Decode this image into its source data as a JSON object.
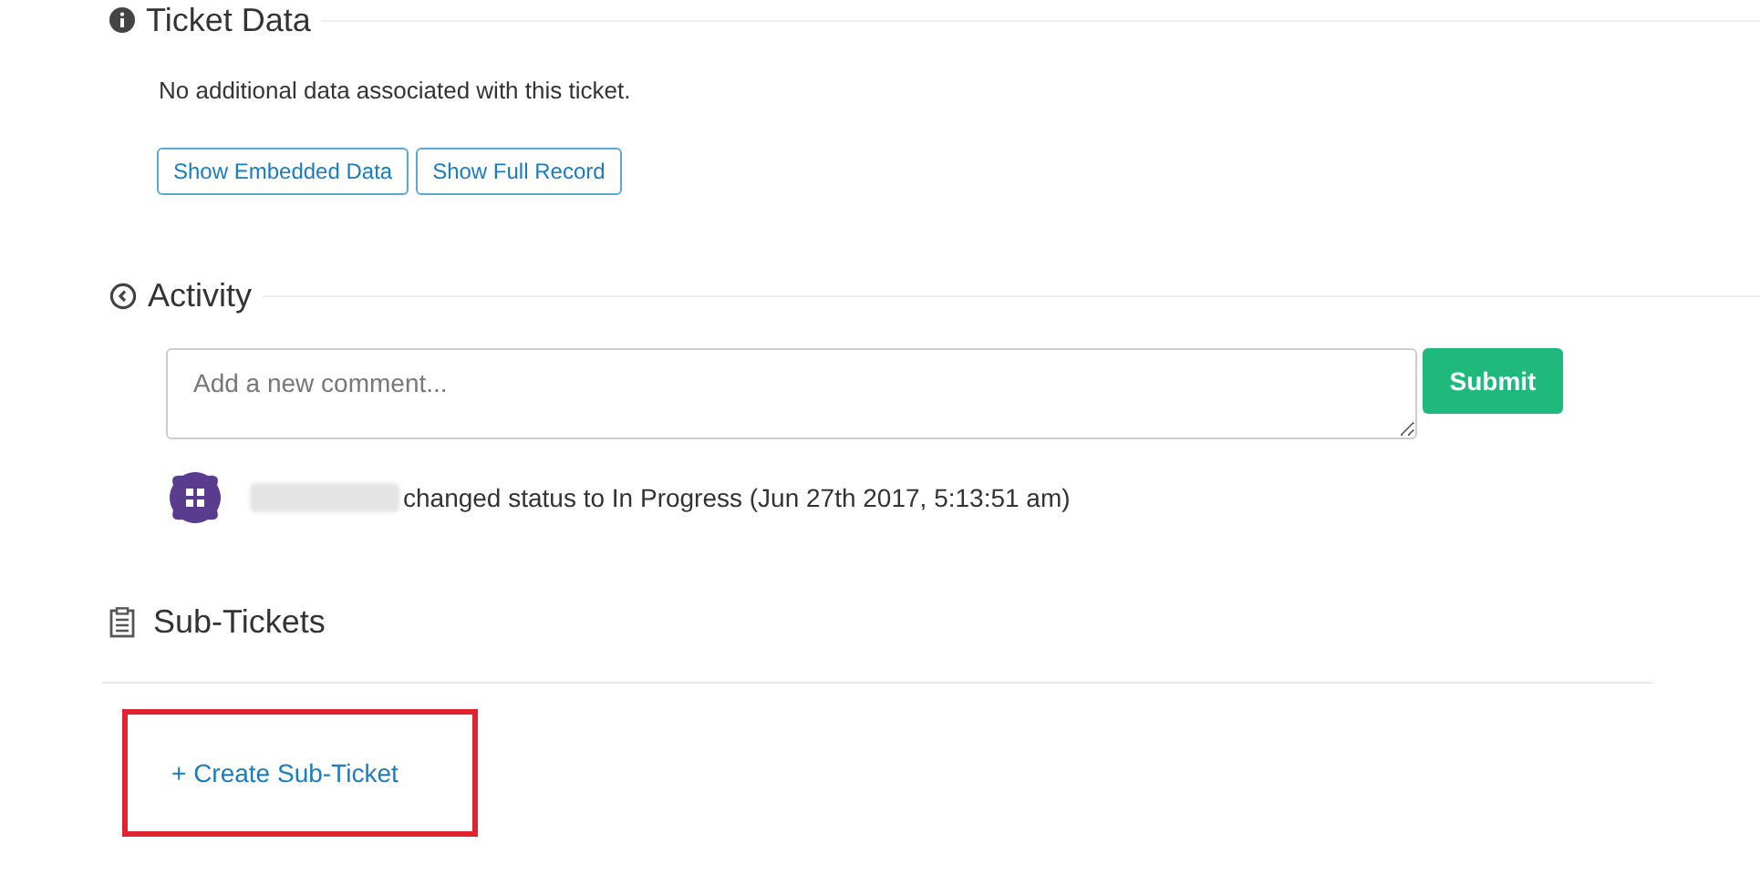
{
  "ticket_data": {
    "title": "Ticket Data",
    "message": "No additional data associated with this ticket.",
    "buttons": [
      "Show Embedded Data",
      "Show Full Record"
    ]
  },
  "activity": {
    "title": "Activity",
    "comment": {
      "placeholder": "Add a new comment..."
    },
    "submit": "Submit",
    "entries": [
      {
        "text": "changed status to In Progress (Jun 27th 2017, 5:13:51 am)"
      }
    ]
  },
  "sub_tickets": {
    "title": "Sub-Tickets",
    "create_link": "+ Create Sub-Ticket",
    "highlighted": true
  }
}
